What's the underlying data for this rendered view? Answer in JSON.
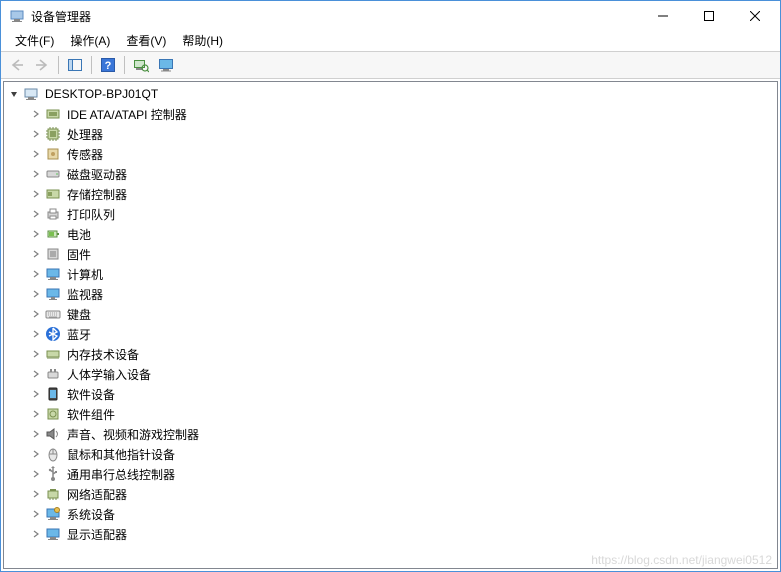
{
  "window": {
    "title": "设备管理器"
  },
  "menu": {
    "file": "文件(F)",
    "action": "操作(A)",
    "view": "查看(V)",
    "help": "帮助(H)"
  },
  "tree": {
    "root": "DESKTOP-BPJ01QT",
    "items": [
      {
        "icon": "ide",
        "label": "IDE ATA/ATAPI 控制器"
      },
      {
        "icon": "cpu",
        "label": "处理器"
      },
      {
        "icon": "sensor",
        "label": "传感器"
      },
      {
        "icon": "disk",
        "label": "磁盘驱动器"
      },
      {
        "icon": "storage",
        "label": "存储控制器"
      },
      {
        "icon": "printq",
        "label": "打印队列"
      },
      {
        "icon": "battery",
        "label": "电池"
      },
      {
        "icon": "firmware",
        "label": "固件"
      },
      {
        "icon": "computer",
        "label": "计算机"
      },
      {
        "icon": "monitor",
        "label": "监视器"
      },
      {
        "icon": "keyboard",
        "label": "键盘"
      },
      {
        "icon": "bluetooth",
        "label": "蓝牙"
      },
      {
        "icon": "memory",
        "label": "内存技术设备"
      },
      {
        "icon": "hid",
        "label": "人体学输入设备"
      },
      {
        "icon": "softdev",
        "label": "软件设备"
      },
      {
        "icon": "softcomp",
        "label": "软件组件"
      },
      {
        "icon": "sound",
        "label": "声音、视频和游戏控制器"
      },
      {
        "icon": "mouse",
        "label": "鼠标和其他指针设备"
      },
      {
        "icon": "usb",
        "label": "通用串行总线控制器"
      },
      {
        "icon": "network",
        "label": "网络适配器"
      },
      {
        "icon": "system",
        "label": "系统设备"
      },
      {
        "icon": "display",
        "label": "显示适配器"
      }
    ]
  },
  "watermark": "https://blog.csdn.net/jiangwei0512"
}
